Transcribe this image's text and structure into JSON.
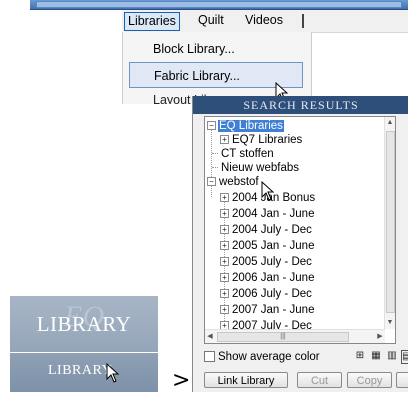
{
  "menu": {
    "items": [
      "Libraries",
      "Quilt",
      "Videos"
    ],
    "dropdown": {
      "items": [
        "Block Library...",
        "Fabric Library..."
      ],
      "cut_item": "Layout Libr"
    }
  },
  "library_panel": {
    "header": "SEARCH RESULTS",
    "tree": [
      {
        "label": "EQ Libraries",
        "box": "−",
        "selected": true
      },
      {
        "label": "EQ7 Libraries",
        "box": "+"
      },
      {
        "label": "CT stoffen"
      },
      {
        "label": "Nieuw webfabs"
      },
      {
        "label": "webstof",
        "box": "−"
      },
      {
        "label": "2004 Jan Bonus",
        "box": "+"
      },
      {
        "label": "2004 Jan - June",
        "box": "+"
      },
      {
        "label": "2004 July - Dec",
        "box": "+"
      },
      {
        "label": "2005 Jan - June",
        "box": "+"
      },
      {
        "label": "2005 July - Dec",
        "box": "+"
      },
      {
        "label": "2006 Jan - June",
        "box": "+"
      },
      {
        "label": "2006 July - Dec",
        "box": "+"
      },
      {
        "label": "2007 Jan - June",
        "box": "+"
      },
      {
        "label": "2007 July - Dec",
        "box": "+"
      }
    ],
    "show_average_color": "Show average color",
    "buttons": {
      "link": "Link Library",
      "cut": "Cut",
      "copy": "Copy"
    }
  },
  "tiles": {
    "big": "LIBRARY",
    "small": "LIBRARY",
    "watermark": "EQ"
  },
  "arrow": ">",
  "colors": {
    "header_bg": "#2e4f7a",
    "selection": "#3f7fd4",
    "tile": "#95a5b9"
  }
}
